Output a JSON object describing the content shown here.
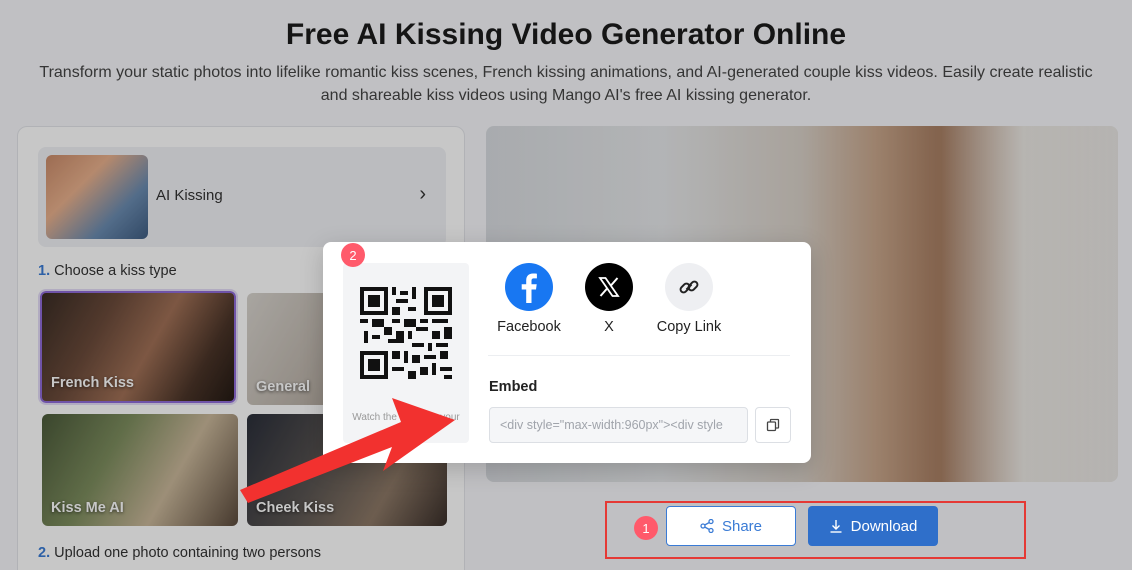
{
  "hero": {
    "title": "Free AI Kissing Video Generator Online",
    "subtitle": "Transform your static photos into lifelike romantic kiss scenes, French kissing animations, and AI-generated couple kiss videos. Easily create realistic and shareable kiss videos using Mango AI's free AI kissing generator."
  },
  "left_panel": {
    "model_name": "AI Kissing",
    "model_chevron": "›",
    "step1_num": "1.",
    "step1_label": "Choose a kiss type",
    "kiss_types": [
      "French Kiss",
      "General",
      "Kiss Me AI",
      "Cheek Kiss"
    ],
    "step2_num": "2.",
    "step2_label": "Upload one photo containing two persons"
  },
  "actions": {
    "share_label": "Share",
    "download_label": "Download",
    "badge_1": "1",
    "badge_2": "2"
  },
  "share_modal": {
    "qr_caption": "Watch the video on your phone",
    "facebook_label": "Facebook",
    "x_label": "X",
    "copy_link_label": "Copy Link",
    "embed_title": "Embed",
    "embed_code": "<div style=\"max-width:960px\"><div style"
  },
  "colors": {
    "accent": "#2f6fca",
    "annotation_red": "#e53935",
    "badge": "#ff5a6b",
    "facebook": "#1877f2",
    "x": "#000000"
  },
  "icons": {
    "share": "share-icon",
    "download": "download-icon",
    "copy": "copy-icon",
    "link": "link-icon"
  }
}
